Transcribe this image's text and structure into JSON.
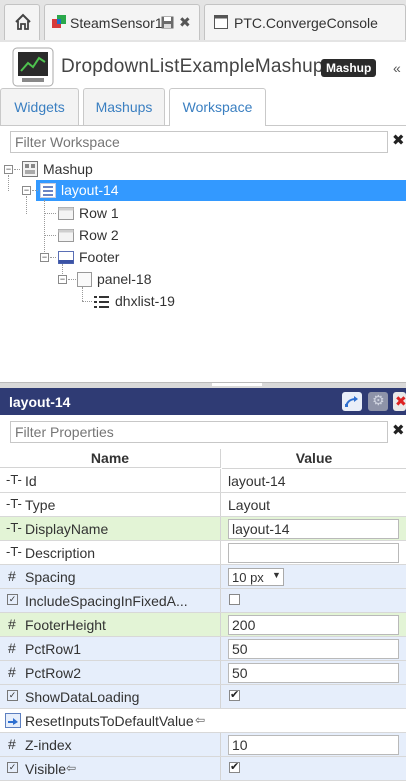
{
  "top_tabs": [
    {
      "label": ""
    },
    {
      "label": "SteamSensor1"
    },
    {
      "label": "PTC.ConvergeConsole"
    }
  ],
  "header": {
    "title": "DropdownListExampleMashup",
    "badge": "Mashup"
  },
  "nav_tabs": [
    {
      "label": "Widgets"
    },
    {
      "label": "Mashups"
    },
    {
      "label": "Workspace"
    }
  ],
  "workspace": {
    "filter_placeholder": "Filter Workspace",
    "tree": [
      {
        "label": "Mashup",
        "icon": "mashup-icon"
      },
      {
        "label": "layout-14",
        "icon": "layout-icon",
        "selected": true
      },
      {
        "label": "Row 1",
        "icon": "row-icon"
      },
      {
        "label": "Row 2",
        "icon": "row-icon"
      },
      {
        "label": "Footer",
        "icon": "footer-icon"
      },
      {
        "label": "panel-18",
        "icon": "panel-icon"
      },
      {
        "label": "dhxlist-19",
        "icon": "list-icon"
      }
    ]
  },
  "properties": {
    "title": "layout-14",
    "filter_placeholder": "Filter Properties",
    "columns": {
      "name": "Name",
      "value": "Value"
    },
    "rows": [
      {
        "name": "Id",
        "icon": "text-property-icon",
        "value": "layout-14",
        "kind": "text"
      },
      {
        "name": "Type",
        "icon": "text-property-icon",
        "value": "Layout",
        "kind": "text"
      },
      {
        "name": "DisplayName",
        "icon": "text-property-icon",
        "value": "layout-14",
        "kind": "input"
      },
      {
        "name": "Description",
        "icon": "text-property-icon",
        "value": "",
        "kind": "input"
      },
      {
        "name": "Spacing",
        "icon": "number-property-icon",
        "value": "10 px",
        "kind": "select"
      },
      {
        "name": "IncludeSpacingInFixedA...",
        "icon": "boolean-property-icon",
        "value": "false",
        "kind": "checkbox"
      },
      {
        "name": "FooterHeight",
        "icon": "number-property-icon",
        "value": "200",
        "kind": "input"
      },
      {
        "name": "PctRow1",
        "icon": "number-property-icon",
        "value": "50",
        "kind": "input"
      },
      {
        "name": "PctRow2",
        "icon": "number-property-icon",
        "value": "50",
        "kind": "input"
      },
      {
        "name": "ShowDataLoading",
        "icon": "boolean-property-icon",
        "value": "true",
        "kind": "checkbox"
      },
      {
        "name": "ResetInputsToDefaultValue",
        "icon": "service-property-icon",
        "value": "",
        "kind": "none"
      },
      {
        "name": "Z-index",
        "icon": "number-property-icon",
        "value": "10",
        "kind": "input"
      },
      {
        "name": "Visible",
        "icon": "boolean-property-icon",
        "value": "true",
        "kind": "checkbox"
      }
    ]
  },
  "colors": {
    "prop_header": "#2f3b74",
    "selected": "#3399ff",
    "tab_text": "#3a7fc1",
    "row_blue": "#e6eefb",
    "row_green": "#e3f4d6"
  }
}
